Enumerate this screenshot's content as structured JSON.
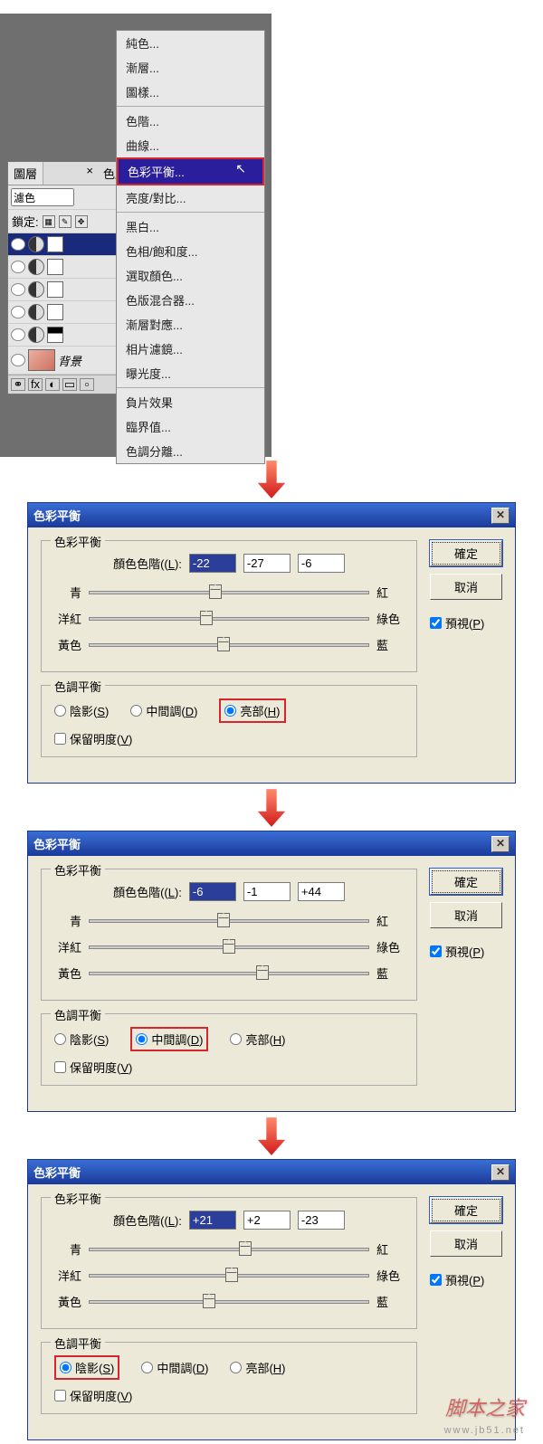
{
  "menu": {
    "items": [
      "純色...",
      "漸層...",
      "圖樣...",
      "色階...",
      "曲線...",
      "色彩平衡...",
      "亮度/對比...",
      "黑白...",
      "色相/飽和度...",
      "選取顏色...",
      "色版混合器...",
      "漸層對應...",
      "相片濾鏡...",
      "曝光度...",
      "負片效果",
      "臨界值...",
      "色調分離..."
    ],
    "highlighted": 5
  },
  "layers_panel": {
    "tabs": [
      "圖層",
      "色版"
    ],
    "blend_mode": "濾色",
    "lock_label": "鎖定:",
    "layer_name": "背景"
  },
  "dialogs": [
    {
      "title": "色彩平衡",
      "group1_title": "色彩平衡",
      "levels_label": "顏色色階(L):",
      "levels": [
        "-22",
        "-27",
        "-6"
      ],
      "slider_positions": [
        45,
        42,
        48
      ],
      "sliders": [
        {
          "left": "青",
          "right": "紅"
        },
        {
          "left": "洋紅",
          "right": "綠色"
        },
        {
          "left": "黃色",
          "right": "藍"
        }
      ],
      "group2_title": "色調平衡",
      "tones": {
        "shadows": "陰影(S)",
        "mid": "中間調(D)",
        "hl": "亮部(H)"
      },
      "selected_tone": "hl",
      "highlighted_tone": "hl",
      "preserve": "保留明度(V)",
      "ok": "確定",
      "cancel": "取消",
      "preview": "預視(P)"
    },
    {
      "title": "色彩平衡",
      "group1_title": "色彩平衡",
      "levels_label": "顏色色階(L):",
      "levels": [
        "-6",
        "-1",
        "+44"
      ],
      "slider_positions": [
        48,
        50,
        62
      ],
      "sliders": [
        {
          "left": "青",
          "right": "紅"
        },
        {
          "left": "洋紅",
          "right": "綠色"
        },
        {
          "left": "黃色",
          "right": "藍"
        }
      ],
      "group2_title": "色調平衡",
      "tones": {
        "shadows": "陰影(S)",
        "mid": "中間調(D)",
        "hl": "亮部(H)"
      },
      "selected_tone": "mid",
      "highlighted_tone": "mid",
      "preserve": "保留明度(V)",
      "ok": "確定",
      "cancel": "取消",
      "preview": "預視(P)"
    },
    {
      "title": "色彩平衡",
      "group1_title": "色彩平衡",
      "levels_label": "顏色色階(L):",
      "levels": [
        "+21",
        "+2",
        "-23"
      ],
      "slider_positions": [
        56,
        51,
        43
      ],
      "sliders": [
        {
          "left": "青",
          "right": "紅"
        },
        {
          "left": "洋紅",
          "right": "綠色"
        },
        {
          "left": "黃色",
          "right": "藍"
        }
      ],
      "group2_title": "色調平衡",
      "tones": {
        "shadows": "陰影(S)",
        "mid": "中間調(D)",
        "hl": "亮部(H)"
      },
      "selected_tone": "shadows",
      "highlighted_tone": "shadows",
      "preserve": "保留明度(V)",
      "ok": "確定",
      "cancel": "取消",
      "preview": "預視(P)"
    }
  ],
  "watermark": "脚本之家",
  "watermark_sub": "www.jb51.net"
}
